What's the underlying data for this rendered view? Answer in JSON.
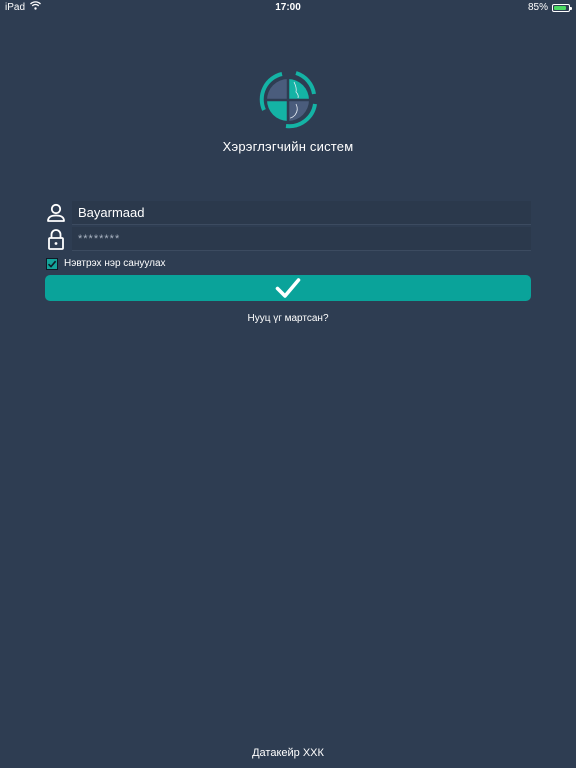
{
  "status_bar": {
    "device": "iPad",
    "time": "17:00",
    "battery": "85%",
    "battery_level": 0.85,
    "wifi_icon": "wifi-icon",
    "battery_icon": "battery-icon"
  },
  "app": {
    "logo_icon": "app-logo-icon",
    "title": "Хэрэглэгчийн систем"
  },
  "login_form": {
    "user_icon": "user-icon",
    "username_value": "Bayarmaad",
    "lock_icon": "lock-icon",
    "password_value": "********",
    "remember_checked": true,
    "remember_label": "Нэвтрэх нэр сануулах",
    "submit_icon": "checkmark-icon",
    "forgot_password": "Нууц үг мартсан?"
  },
  "footer": {
    "company": "Датакейр ХХК"
  },
  "colors": {
    "background": "#2e3d52",
    "accent": "#0aa39a",
    "text": "#ffffff"
  }
}
